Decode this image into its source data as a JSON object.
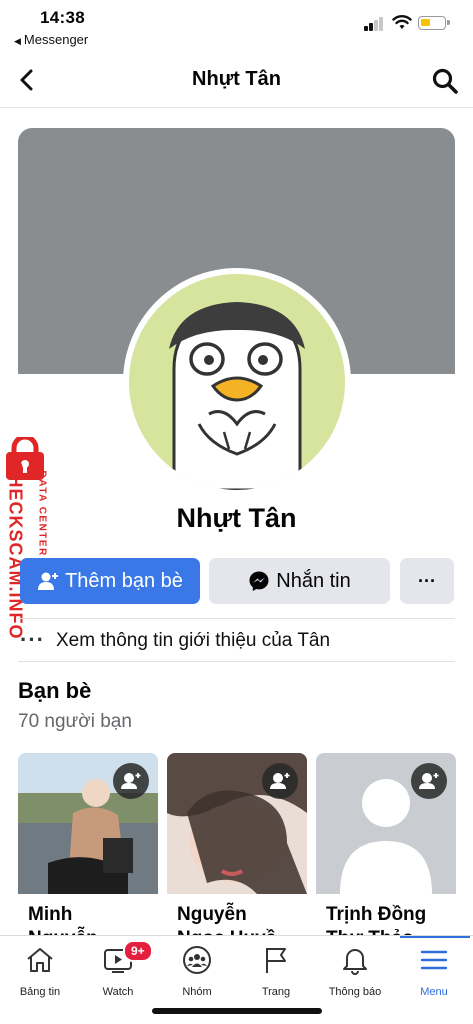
{
  "status_bar": {
    "time": "14:38",
    "back_app": "Messenger",
    "battery_color": "#f5c400"
  },
  "nav": {
    "title": "Nhựt Tân",
    "back_icon": "chevron-left-icon",
    "search_icon": "search-icon"
  },
  "profile": {
    "name": "Nhựt Tân",
    "cover_color": "#8a8d90",
    "avatar_bg": "#d6e49d"
  },
  "watermark": {
    "main": "CHECKSCAM.INFO",
    "sub": "DATA CENTER",
    "color": "#e02626"
  },
  "actions": {
    "add_friend": "Thêm bạn bè",
    "message": "Nhắn tin",
    "more": "···",
    "accent": "#3b78e7"
  },
  "intro": {
    "text": "Xem thông tin giới thiệu của Tân"
  },
  "friends": {
    "title": "Bạn bè",
    "count": "70 người bạn",
    "cards": [
      {
        "line1": "Minh",
        "line2": "Nguyễn"
      },
      {
        "line1": "Nguyễn",
        "line2": "Ngọc Huyề"
      },
      {
        "line1": "Trịnh Đồng",
        "line2": "Thư Thảo"
      }
    ]
  },
  "tabbar": {
    "tabs": [
      {
        "label": "Bảng tin",
        "icon": "home-icon"
      },
      {
        "label": "Watch",
        "icon": "watch-icon",
        "badge": "9+"
      },
      {
        "label": "Nhóm",
        "icon": "groups-icon"
      },
      {
        "label": "Trang",
        "icon": "flag-icon"
      },
      {
        "label": "Thông báo",
        "icon": "bell-icon"
      },
      {
        "label": "Menu",
        "icon": "menu-icon",
        "active": true
      }
    ],
    "active_color": "#2f6fdb",
    "badge_color": "#e41e3f"
  }
}
